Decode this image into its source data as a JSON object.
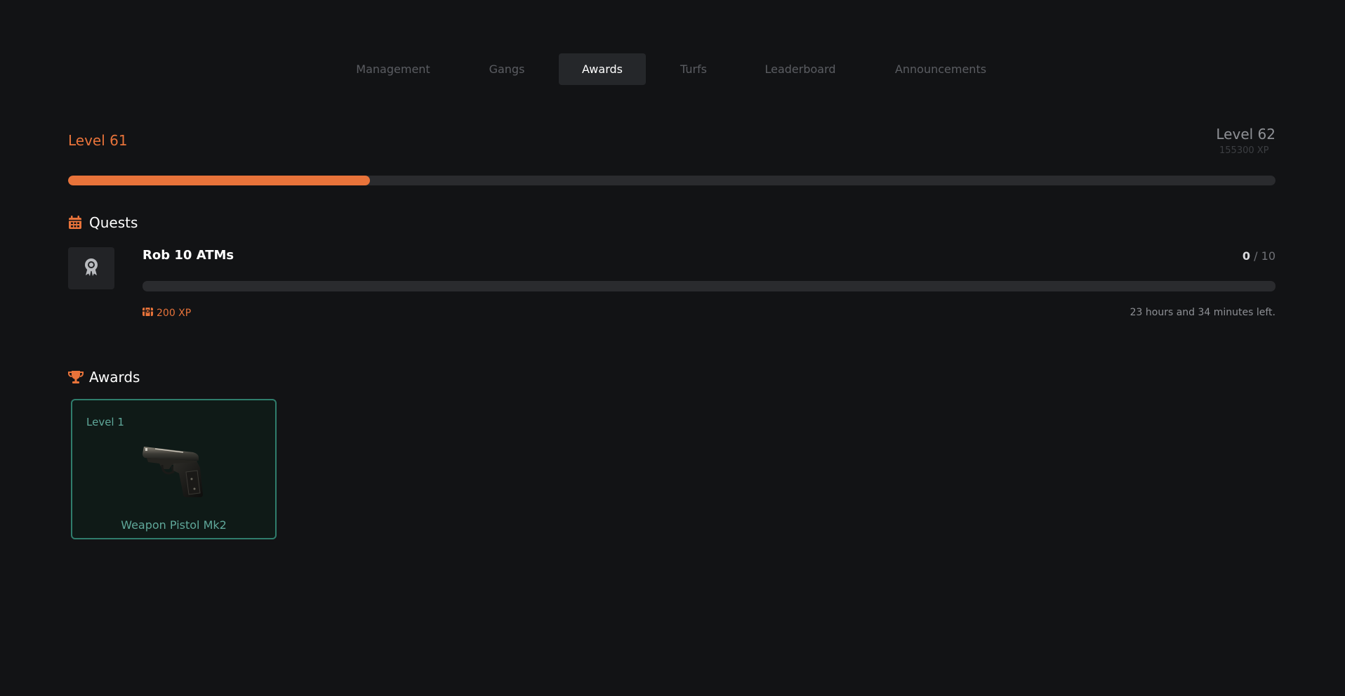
{
  "tabs": [
    {
      "label": "Management",
      "active": false
    },
    {
      "label": "Gangs",
      "active": false
    },
    {
      "label": "Awards",
      "active": true
    },
    {
      "label": "Turfs",
      "active": false
    },
    {
      "label": "Leaderboard",
      "active": false
    },
    {
      "label": "Announcements",
      "active": false
    }
  ],
  "level": {
    "current_label": "Level 61",
    "next_label": "Level 62",
    "next_xp": "155300 XP",
    "progress": 0.25
  },
  "quests": {
    "heading": "Quests",
    "icon": "calendar-icon",
    "items": [
      {
        "title": "Rob 10 ATMs",
        "current": "0",
        "total": "/ 10",
        "progress": 0,
        "reward": "200 XP",
        "reward_icon": "treasure-chest-icon",
        "time_left": "23 hours and 34 minutes left.",
        "icon": "award-ribbon-icon"
      }
    ]
  },
  "awards": {
    "heading": "Awards",
    "icon": "trophy-icon",
    "items": [
      {
        "level": "Level 1",
        "name": "Weapon Pistol Mk2",
        "image": "pistol-image"
      }
    ]
  },
  "colors": {
    "background": "#121315",
    "accent": "#e8733a",
    "award_border": "#2f7d6c",
    "award_text": "#5fa89a",
    "tab_inactive": "#5b5d62",
    "tab_active_bg": "#25272a"
  }
}
